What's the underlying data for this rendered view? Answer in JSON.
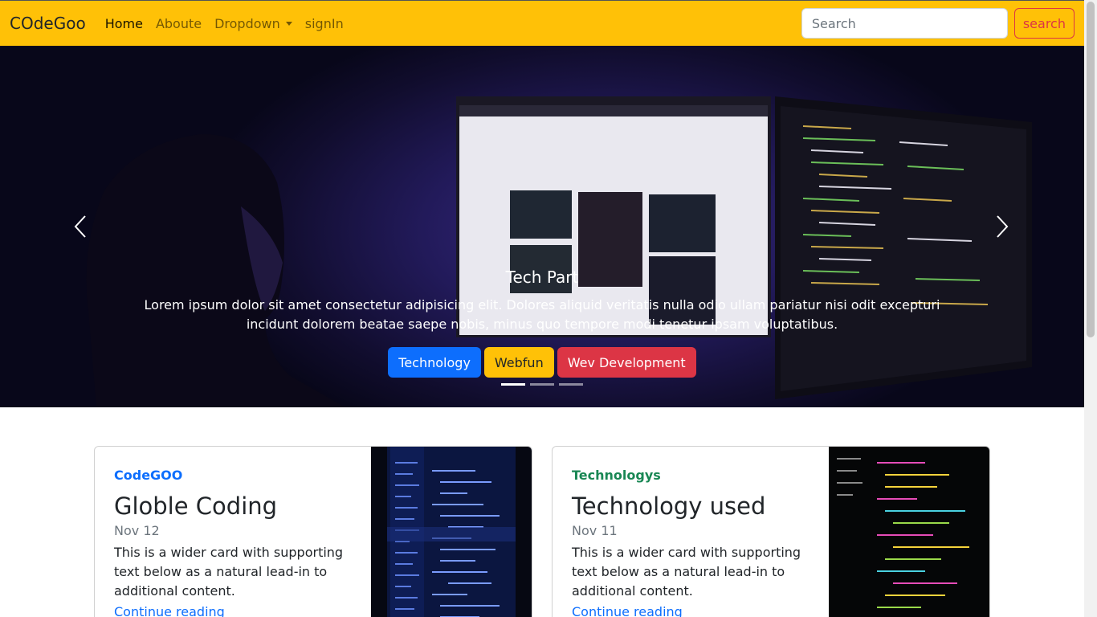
{
  "navbar": {
    "brand": "COdeGoo",
    "links": [
      {
        "label": "Home",
        "active": true
      },
      {
        "label": "Aboute",
        "active": false
      },
      {
        "label": "Dropdown",
        "active": false
      },
      {
        "label": "signIn",
        "active": false
      }
    ],
    "search_placeholder": "Search",
    "search_button": "search",
    "colors": {
      "background": "#ffc107",
      "search_button": "#dc3545"
    }
  },
  "carousel": {
    "caption_title": "Tech Part",
    "caption_text": "Lorem ipsum dolor sit amet consectetur adipisicing elit. Dolores aliquid veritatis nulla odio ullam pariatur nisi odit excepturi incidunt dolorem beatae saepe nobis, minus quo tempore modi tenetur ipsam voluptatibus.",
    "tags": [
      {
        "label": "Technology",
        "color": "#0d6efd"
      },
      {
        "label": "Webfun",
        "color": "#ffc107"
      },
      {
        "label": "Wev Development",
        "color": "#dc3545"
      }
    ],
    "slide_count": 3,
    "active_slide": 1,
    "prev_icon": "chevron-left-icon",
    "next_icon": "chevron-right-icon"
  },
  "cards": [
    {
      "category": "CodeGOO",
      "category_color": "#0d6efd",
      "title": "Globle Coding",
      "date": "Nov 12",
      "text": "This is a wider card with supporting text below as a natural lead-in to additional content.",
      "link": "Continue reading"
    },
    {
      "category": "Technologys",
      "category_color": "#198754",
      "title": "Technology used",
      "date": "Nov 11",
      "text": "This is a wider card with supporting text below as a natural lead-in to additional content.",
      "link": "Continue reading"
    }
  ]
}
